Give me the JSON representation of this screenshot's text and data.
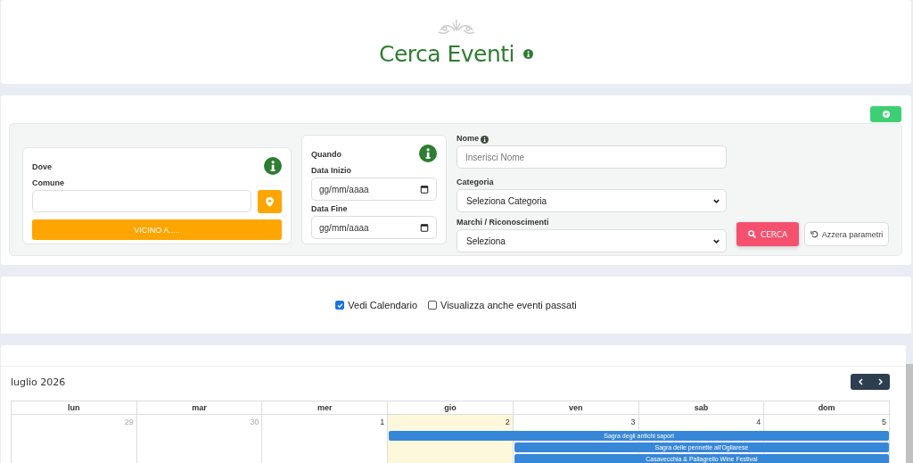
{
  "header": {
    "title": "Cerca Eventi"
  },
  "search": {
    "dove": {
      "title": "Dove",
      "comune_label": "Comune",
      "vicino_button": "VICINO A....."
    },
    "quando": {
      "title": "Quando",
      "start_label": "Data Inizio",
      "start_placeholder": "gg/mm/aaaa",
      "end_label": "Data Fine",
      "end_placeholder": "gg/mm/aaaa"
    },
    "nome_label": "Nome",
    "nome_placeholder": "Inserisci Nome",
    "categoria_label": "Categoria",
    "categoria_value": "Seleziona Categoria",
    "marchi_label": "Marchi / Riconoscimenti",
    "marchi_value": "Seleziona",
    "search_button": "CERCA",
    "reset_button": "Azzera parametri"
  },
  "options": [
    {
      "label": "Vedi Calendario",
      "checked": true
    },
    {
      "label": "Visualizza anche eventi passati",
      "checked": false
    }
  ],
  "calendar": {
    "title": "luglio 2026",
    "weekdays": [
      "lun",
      "mar",
      "mer",
      "gio",
      "ven",
      "sab",
      "dom"
    ],
    "days": [
      {
        "number": "29",
        "outside": true,
        "today": false
      },
      {
        "number": "30",
        "outside": true,
        "today": false
      },
      {
        "number": "1",
        "outside": false,
        "today": false
      },
      {
        "number": "2",
        "outside": false,
        "today": true,
        "events": [
          "Sagra degli antichi sapori"
        ]
      },
      {
        "number": "3",
        "outside": false,
        "today": false,
        "events": [
          "Sagra delle pennette all'Ogliarese",
          "Casavecchia & Pallagrello Wine Festival"
        ]
      },
      {
        "number": "4",
        "outside": false,
        "today": false
      },
      {
        "number": "5",
        "outside": false,
        "today": false
      }
    ]
  }
}
